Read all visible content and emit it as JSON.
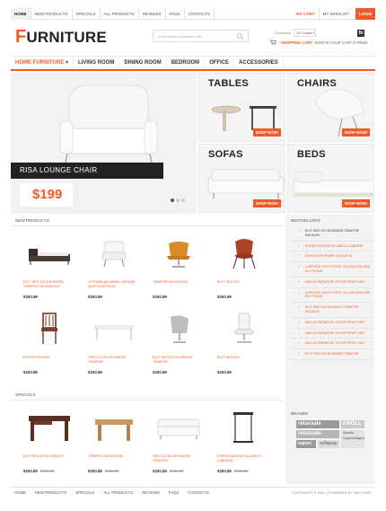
{
  "topnav": {
    "items": [
      "Home",
      "New products",
      "Specials",
      "All products",
      "Reviews",
      "FAQs",
      "Contacts"
    ],
    "my_cart": "My cart",
    "my_wishlist": "My wishlist",
    "login": "Login"
  },
  "header": {
    "logo_first": "F",
    "logo_rest": "URNITURE",
    "search_placeholder": "enter search keywords here",
    "currency_label": "Currencies",
    "currency_value": "US Dollar",
    "fb_letter": "fb",
    "cart_label": "Shopping cart:",
    "cart_value": "now in your cart 0 items"
  },
  "mainnav": {
    "items": [
      "Home Furniture",
      "Living room",
      "Dining room",
      "Bedroom",
      "Office",
      "Accessories"
    ]
  },
  "hero": {
    "title": "Risa lounge chair",
    "price": "$199"
  },
  "tiles": [
    {
      "title": "Tables",
      "button": "Shop now!"
    },
    {
      "title": "Chairs",
      "button": "Shop now!"
    },
    {
      "title": "Sofas",
      "button": "Shop now!"
    },
    {
      "title": "Beds",
      "button": "Shop now!"
    }
  ],
  "new_products": {
    "title": "New products",
    "items": [
      {
        "name": "Elit sed do eiusmod tempor incididunt",
        "price": "$250.89"
      },
      {
        "name": "Ut enim ad minim veniam, quis nostrud",
        "price": "$250.89"
      },
      {
        "name": "Tempor incididun",
        "price": "$250.89"
      },
      {
        "name": "Elit sed do",
        "price": "$250.89"
      },
      {
        "name": "Exercitation",
        "price": "$250.89"
      },
      {
        "name": "Sed do do eiusmod tempor",
        "price": "$250.89"
      },
      {
        "name": "Elit sed do eiusmod tempor",
        "price": "$250.89"
      },
      {
        "name": "Elit sed do",
        "price": "$250.89"
      }
    ]
  },
  "specials": {
    "title": "Specials",
    "items": [
      {
        "name": "Elit sed do eiusmod",
        "price": "$250.89",
        "old": "$650.89"
      },
      {
        "name": "Tempor incididun",
        "price": "$250.89",
        "old": "$650.89"
      },
      {
        "name": "Sed do do eiusmod tempor",
        "price": "$250.89",
        "old": "$650.89"
      },
      {
        "name": "Exercitation ullamco laboris",
        "price": "$250.89",
        "old": "$650.89"
      }
    ]
  },
  "bestsellers": {
    "title": "Bestsellers",
    "items": [
      "Elit sed do eiusmod tempor incidun",
      "Exercitation ullamco laboris",
      "Duis aute irure dolor in",
      "Lupitate velit esse cillum dolore eu fugiat",
      "Nulla pariatur. Excepteur sint",
      "Lupitate velit esse cillum dolore eu fugiat",
      "Elit sed do eiusmod tempor incidun",
      "Nulla pariatur. Excepteur sint",
      "Nulla pariatur. Excepteur sint",
      "Nulla pariatur. Excepteur sint",
      "Elit sed do eiusmod tempor"
    ]
  },
  "brands": {
    "title": "Brands",
    "names": [
      "relaxsale",
      "KNOLL",
      "Studio Copenhagen",
      "mpurc",
      "sofapop"
    ]
  },
  "footer": {
    "items": [
      "Home",
      "New products",
      "Specials",
      "All products",
      "Reviews",
      "FAQs",
      "Contacts"
    ],
    "copyright": "Copyright © 2012 | Powered by Zen Cart"
  },
  "colors": {
    "accent": "#ef5a28"
  }
}
